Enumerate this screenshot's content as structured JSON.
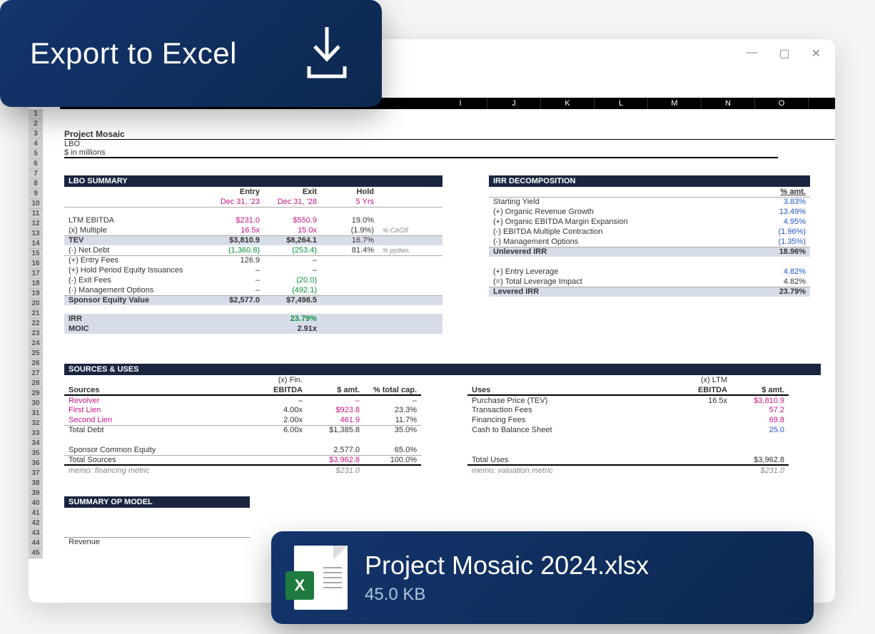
{
  "export": {
    "label": "Export to Excel"
  },
  "file": {
    "name": "Project Mosaic 2024.xlsx",
    "size": "45.0 KB"
  },
  "columns": [
    "I",
    "J",
    "K",
    "L",
    "M",
    "N",
    "O"
  ],
  "project": {
    "title": "Project Mosaic",
    "model": "LBO",
    "units": "$ in millions"
  },
  "lbo_summary": {
    "title": "LBO SUMMARY",
    "headers": {
      "entry": "Entry",
      "exit": "Exit",
      "hold": "Hold"
    },
    "dates": {
      "entry": "Dec 31, '23",
      "exit": "Dec 31, '28",
      "hold": "5 Yrs"
    },
    "rows": [
      {
        "label": "LTM EBITDA",
        "entry": "$231.0",
        "exit": "$550.9",
        "right": "19.0%"
      },
      {
        "label": "(x) Multiple",
        "entry": "16.5x",
        "exit": "15.0x",
        "right": "(1.9%)",
        "note": "% CAGR"
      },
      {
        "label": "TEV",
        "entry": "$3,810.9",
        "exit": "$8,264.1",
        "right": "16.7%",
        "shaded": true
      },
      {
        "label": "(-) Net Debt",
        "entry": "(1,360.8)",
        "exit": "(253.4)",
        "right": "81.4%",
        "note": "% pydwn.",
        "neg": true
      },
      {
        "label": "(+) Entry Fees",
        "entry": "126.9",
        "exit": "–"
      },
      {
        "label": "(+) Hold Period Equity Issuances",
        "entry": "–",
        "exit": "–"
      },
      {
        "label": "(-) Exit Fees",
        "entry": "–",
        "exit": "(20.0)"
      },
      {
        "label": "(-) Management Options",
        "entry": "–",
        "exit": "(492.1)"
      },
      {
        "label": "Sponsor Equity Value",
        "entry": "$2,577.0",
        "exit": "$7,498.5",
        "shaded": true
      }
    ],
    "metrics": {
      "irr_label": "IRR",
      "irr": "23.79%",
      "moic_label": "MOIC",
      "moic": "2.91x"
    }
  },
  "irr_decomp": {
    "title": "IRR DECOMPOSITION",
    "amt_header": "% amt.",
    "rows": [
      {
        "label": "Starting Yield",
        "val": "3.83%",
        "blue": true
      },
      {
        "label": "(+) Organic Revenue Growth",
        "val": "13.49%",
        "blue": true
      },
      {
        "label": "(+) Organic EBITDA Margin Expansion",
        "val": "4.95%",
        "blue": true
      },
      {
        "label": "(-) EBITDA Multiple Contraction",
        "val": "(1.96%)",
        "blue": true
      },
      {
        "label": "(-) Management Options",
        "val": "(1.35%)",
        "blue": true
      },
      {
        "label": "Unlevered IRR",
        "val": "18.96%",
        "shaded": true,
        "bold": true
      },
      {
        "label": "",
        "val": ""
      },
      {
        "label": "(+) Entry Leverage",
        "val": "4.82%",
        "blue": true
      },
      {
        "label": "(=) Total Leverage Impact",
        "val": "4.82%"
      },
      {
        "label": "Levered IRR",
        "val": "23.79%",
        "shaded": true,
        "bold": true
      }
    ]
  },
  "sources_uses": {
    "title": "SOURCES & USES",
    "sources_hdr": {
      "col0": "Sources",
      "col1": "(x) Fin.",
      "col2": "EBITDA",
      "col3": "$ amt.",
      "col4": "% total cap."
    },
    "sources": [
      {
        "label": "Revolver",
        "mult": "–",
        "amt": "–",
        "pct": "–",
        "pink": true
      },
      {
        "label": "First Lien",
        "mult": "4.00x",
        "amt": "$923.8",
        "pct": "23.3%",
        "pink": true
      },
      {
        "label": "Second Lien",
        "mult": "2.00x",
        "amt": "461.9",
        "pct": "11.7%",
        "pink": true
      },
      {
        "label": "Total Debt",
        "mult": "6.00x",
        "amt": "$1,385.8",
        "pct": "35.0%"
      },
      {
        "label": "",
        "mult": "",
        "amt": "",
        "pct": ""
      },
      {
        "label": "Sponsor Common Equity",
        "mult": "",
        "amt": "2,577.0",
        "pct": "65.0%"
      },
      {
        "label": "Total Sources",
        "mult": "",
        "amt": "$3,962.8",
        "pct": "100.0%",
        "pinkamt": true
      },
      {
        "label": "memo: financing metric",
        "mult": "",
        "amt": "$231.0",
        "pct": "",
        "italic": true
      }
    ],
    "uses_hdr": {
      "col0": "Uses",
      "col1": "(x) LTM",
      "col2": "EBITDA",
      "col3": "$ amt."
    },
    "uses": [
      {
        "label": "Purchase Price (TEV)",
        "mult": "16.5x",
        "amt": "$3,810.9",
        "pinkamt": true
      },
      {
        "label": "Transaction Fees",
        "mult": "",
        "amt": "57.2",
        "pinkamt": true
      },
      {
        "label": "Financing Fees",
        "mult": "",
        "amt": "69.8",
        "pinkamt": true
      },
      {
        "label": "Cash to Balance Sheet",
        "mult": "",
        "amt": "25.0",
        "blueamt": true
      },
      {
        "label": "",
        "mult": "",
        "amt": ""
      },
      {
        "label": "",
        "mult": "",
        "amt": ""
      },
      {
        "label": "Total Uses",
        "mult": "",
        "amt": "$3,962.8"
      },
      {
        "label": "memo: valuation metric",
        "mult": "",
        "amt": "$231.0",
        "italic": true
      }
    ]
  },
  "op_model": {
    "title": "SUMMARY OP MODEL",
    "rev_label": "Revenue"
  }
}
